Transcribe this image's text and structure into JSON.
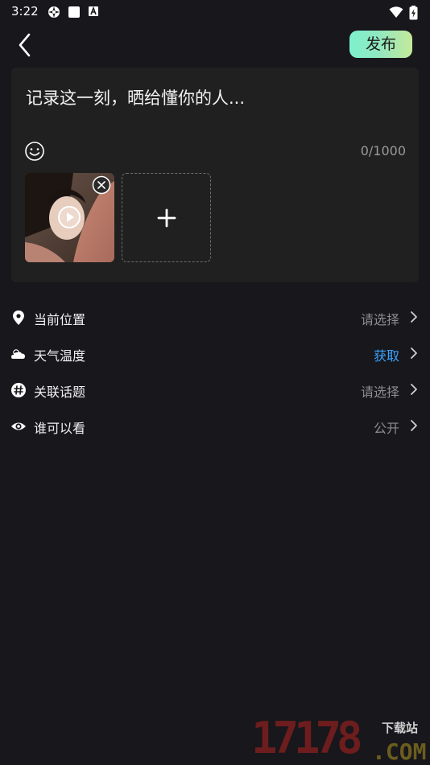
{
  "status_bar": {
    "time": "3:22"
  },
  "header": {
    "publish_label": "发布"
  },
  "composer": {
    "placeholder": "记录这一刻，晒给懂你的人...",
    "char_count": "0/1000"
  },
  "settings": [
    {
      "label": "当前位置",
      "value": "请选择",
      "icon": "location-pin-icon"
    },
    {
      "label": "天气温度",
      "value": "获取",
      "icon": "cloud-icon",
      "value_color": "#3aa3ff"
    },
    {
      "label": "关联话题",
      "value": "请选择",
      "icon": "hashtag-icon"
    },
    {
      "label": "谁可以看",
      "value": "公开",
      "icon": "eye-icon"
    }
  ],
  "watermark": {
    "number": "17178",
    "domain": ".COM",
    "tag": "下载站"
  },
  "colors": {
    "background": "#17171c",
    "panel": "#202020",
    "accent": "#3aa3ff",
    "publish_gradient": [
      "#7ff1cf",
      "#c5e99a"
    ]
  }
}
